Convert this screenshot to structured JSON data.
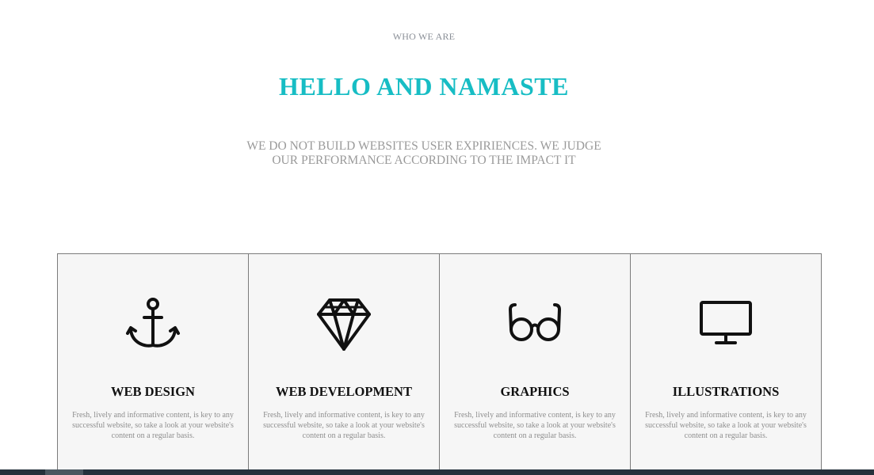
{
  "section": {
    "eyebrow": "WHO WE ARE",
    "headline": "HELLO AND NAMASTE",
    "intro": "WE DO NOT BUILD WEBSITES USER EXPIRIENCES. WE JUDGE OUR PERFORMANCE ACCORDING TO THE IMPACT IT"
  },
  "colors": {
    "accent": "#17bdc4",
    "card_background": "#f6f6f6",
    "card_border": "#7b7b7b",
    "footer_bar": "#24313b"
  },
  "services": [
    {
      "icon": "anchor-icon",
      "title": "WEB DESIGN",
      "description": "Fresh, lively and informative content, is key to any successful website, so take a look at your website's content on a regular basis."
    },
    {
      "icon": "diamond-icon",
      "title": "WEB DEVELOPMENT",
      "description": "Fresh, lively and informative content, is key to any successful website, so take a look at your website's content on a regular basis."
    },
    {
      "icon": "glasses-icon",
      "title": "GRAPHICS",
      "description": "Fresh, lively and informative content, is key to any successful website, so take a look at your website's content on a regular basis."
    },
    {
      "icon": "monitor-icon",
      "title": "ILLUSTRATIONS",
      "description": "Fresh, lively and informative content, is key to any successful website, so take a look at your website's content on a regular basis."
    }
  ]
}
